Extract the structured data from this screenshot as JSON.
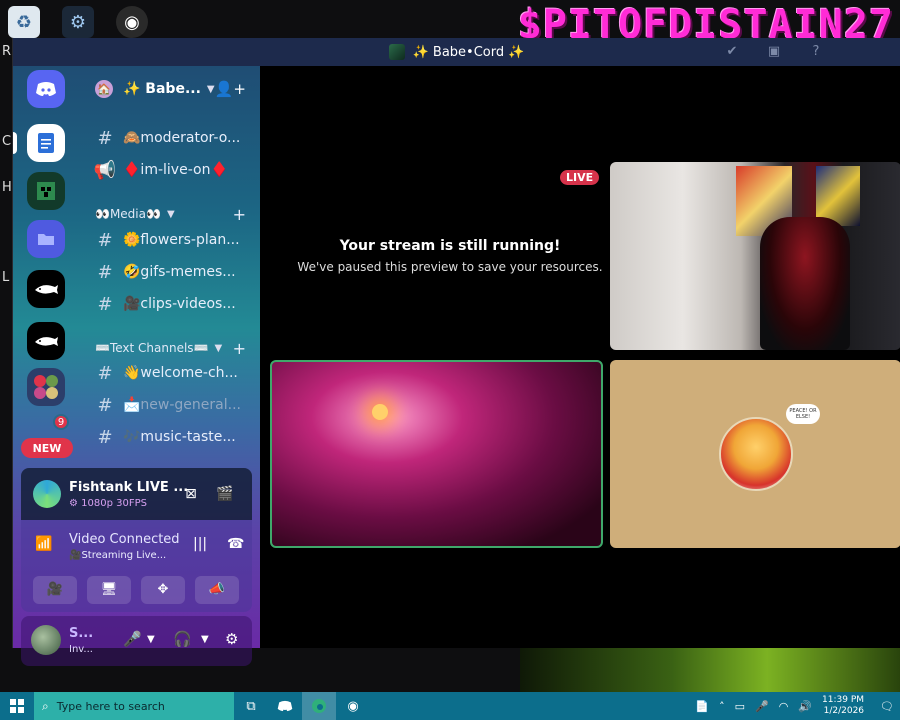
{
  "desktop": {
    "banner": "$PITOFDISTAIN27",
    "edge_letters": [
      "R",
      "C",
      "H",
      "L"
    ]
  },
  "window": {
    "title": "✨ Babe•Cord ✨"
  },
  "server": {
    "name": "✨ Babe..."
  },
  "channels": [
    {
      "label": "🙈moderator-o...",
      "type": "text",
      "muted": false
    },
    {
      "label": "♦️im-live-on♦️",
      "type": "announce",
      "muted": false
    }
  ],
  "categories": [
    {
      "label": "👀Media👀"
    },
    {
      "label": "⌨️Text Channels⌨️"
    }
  ],
  "media_channels": [
    {
      "label": "🌼flowers-plan..."
    },
    {
      "label": "🤣gifs-memes..."
    },
    {
      "label": "🎥clips-videos..."
    }
  ],
  "text_channels": [
    {
      "label": "👋welcome-ch...",
      "muted": false
    },
    {
      "label": "📩new-general...",
      "muted": true
    },
    {
      "label": "🎶music-taste...",
      "muted": false
    }
  ],
  "guild_rail": {
    "new_label": "NEW",
    "unread_count": "9"
  },
  "stream_panel": {
    "title": "Fishtank LIVE ...",
    "quality": "1080p 30FPS"
  },
  "voice_panel": {
    "title": "Video Connected",
    "subtitle": "🎥Streaming Live..."
  },
  "user_panel": {
    "name": "S...",
    "status": "Inv..."
  },
  "stage": {
    "live_badge": "LIVE",
    "paused_title": "Your stream is still running!",
    "paused_sub": "We've paused this preview to save your resources."
  },
  "ash_bubble": "PEACE! OR ELSE!",
  "taskbar": {
    "search_placeholder": "Type here to search",
    "time": "11:39 PM",
    "date": "1/2/2026"
  }
}
